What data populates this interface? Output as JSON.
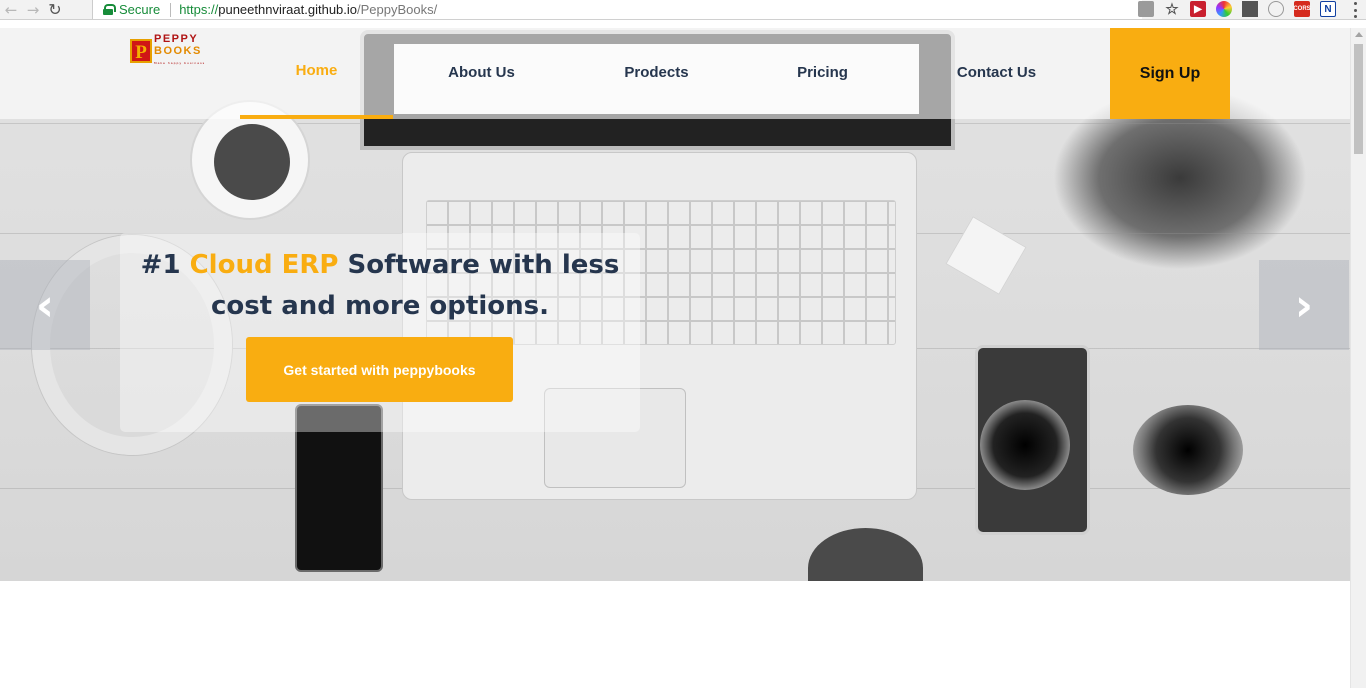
{
  "browser": {
    "secure_label": "Secure",
    "url_scheme": "https://",
    "url_host": "puneethnviraat.github.io",
    "url_path": "/PeppyBooks/"
  },
  "logo": {
    "mark": "P",
    "line1": "PEPPY",
    "line2": "BOOKS",
    "tagline": "Make happy business"
  },
  "nav": {
    "items": [
      {
        "label": "Home",
        "active": true
      },
      {
        "label": "About Us"
      },
      {
        "label": "Prodects"
      },
      {
        "label": "Pricing"
      },
      {
        "label": "Contact Us"
      }
    ],
    "signup_label": "Sign Up"
  },
  "hero": {
    "headline_prefix": "#1 ",
    "headline_accent": "Cloud ERP",
    "headline_rest_1": " Software with less",
    "headline_line_2": "cost and more options.",
    "cta_label": "Get started with peppybooks",
    "prev_glyph": "‹",
    "next_glyph": "›"
  },
  "colors": {
    "accent": "#f9ad11",
    "navy": "#26364e"
  }
}
